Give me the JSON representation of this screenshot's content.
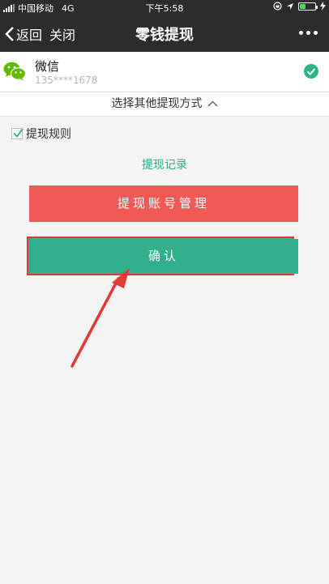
{
  "status_bar": {
    "carrier": "中国移动",
    "network": "4G",
    "time": "下午5:58",
    "battery_level": 0.4
  },
  "nav": {
    "back_label": "返回",
    "close_label": "关闭",
    "title": "零钱提现"
  },
  "account": {
    "name": "微信",
    "number": "135****1678",
    "selected": true
  },
  "other_methods": {
    "label": "选择其他提现方式"
  },
  "rules": {
    "label": "提现规则",
    "checked": true
  },
  "record_link": {
    "label": "提现记录"
  },
  "buttons": {
    "manage_label": "提现账号管理",
    "confirm_label": "确认"
  },
  "colors": {
    "bar": "#2c2c2e",
    "accent_green": "#32b08d",
    "manage_red": "#ef5a57",
    "annotation_red": "#e53935"
  },
  "icons": {
    "back": "chevron-left-icon",
    "more": "more-dots-icon",
    "account": "wechat-icon",
    "selected": "check-circle-icon",
    "expand": "chevron-up-icon"
  }
}
